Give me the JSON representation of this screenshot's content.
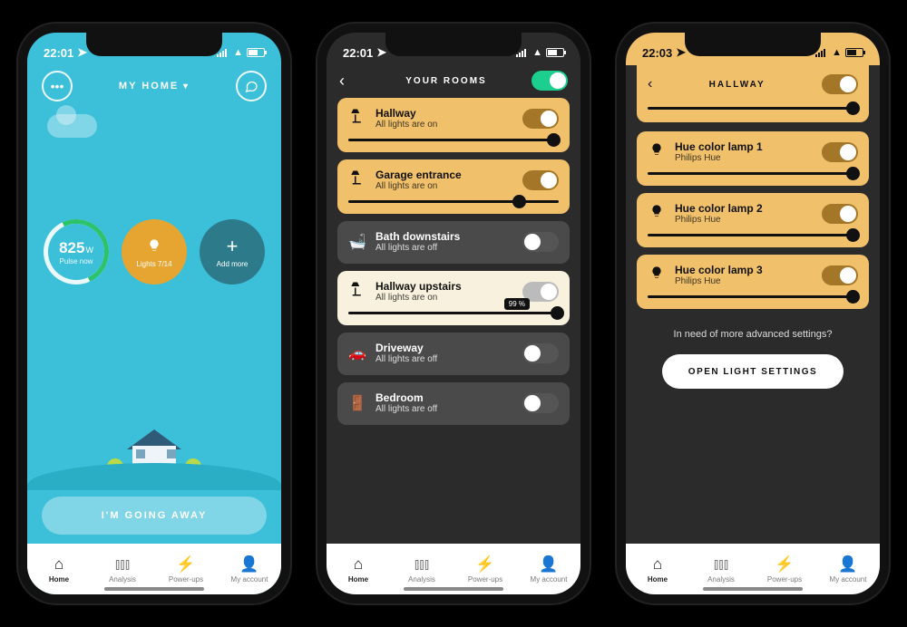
{
  "phone1": {
    "status_time": "22:01",
    "header_title": "MY HOME",
    "pulse_value": "825",
    "pulse_unit": "W",
    "pulse_label": "Pulse now",
    "lights_label": "Lights 7/14",
    "add_label": "Add more",
    "away_btn": "I'M GOING AWAY"
  },
  "phone2": {
    "status_time": "22:01",
    "title": "YOUR ROOMS",
    "rooms": [
      {
        "name": "Hallway",
        "status": "All lights are on",
        "on": true,
        "style": "on",
        "icon": "lamp",
        "slider": 100
      },
      {
        "name": "Garage entrance",
        "status": "All lights are on",
        "on": true,
        "style": "on",
        "icon": "lamp",
        "slider": 78
      },
      {
        "name": "Bath downstairs",
        "status": "All lights are off",
        "on": false,
        "style": "off",
        "icon": "bath"
      },
      {
        "name": "Hallway upstairs",
        "status": "All lights are on",
        "on": true,
        "style": "cream",
        "icon": "lamp",
        "slider": 99,
        "badge": "99 %"
      },
      {
        "name": "Driveway",
        "status": "All lights are off",
        "on": false,
        "style": "off",
        "icon": "car"
      },
      {
        "name": "Bedroom",
        "status": "All lights are off",
        "on": false,
        "style": "off",
        "icon": "door"
      }
    ]
  },
  "phone3": {
    "status_time": "22:03",
    "title": "HALLWAY",
    "lamps": [
      {
        "name": "Hue color lamp 1",
        "sub": "Philips Hue",
        "on": true
      },
      {
        "name": "Hue color lamp 2",
        "sub": "Philips Hue",
        "on": true
      },
      {
        "name": "Hue color lamp 3",
        "sub": "Philips Hue",
        "on": true
      }
    ],
    "adv_q": "In need of more advanced settings?",
    "open_btn": "OPEN LIGHT SETTINGS"
  },
  "tabs": [
    {
      "label": "Home",
      "icon": "home-icon",
      "active": true
    },
    {
      "label": "Analysis",
      "icon": "chart-icon",
      "active": false
    },
    {
      "label": "Power-ups",
      "icon": "bolt-icon",
      "active": false
    },
    {
      "label": "My account",
      "icon": "user-icon",
      "active": false
    }
  ]
}
